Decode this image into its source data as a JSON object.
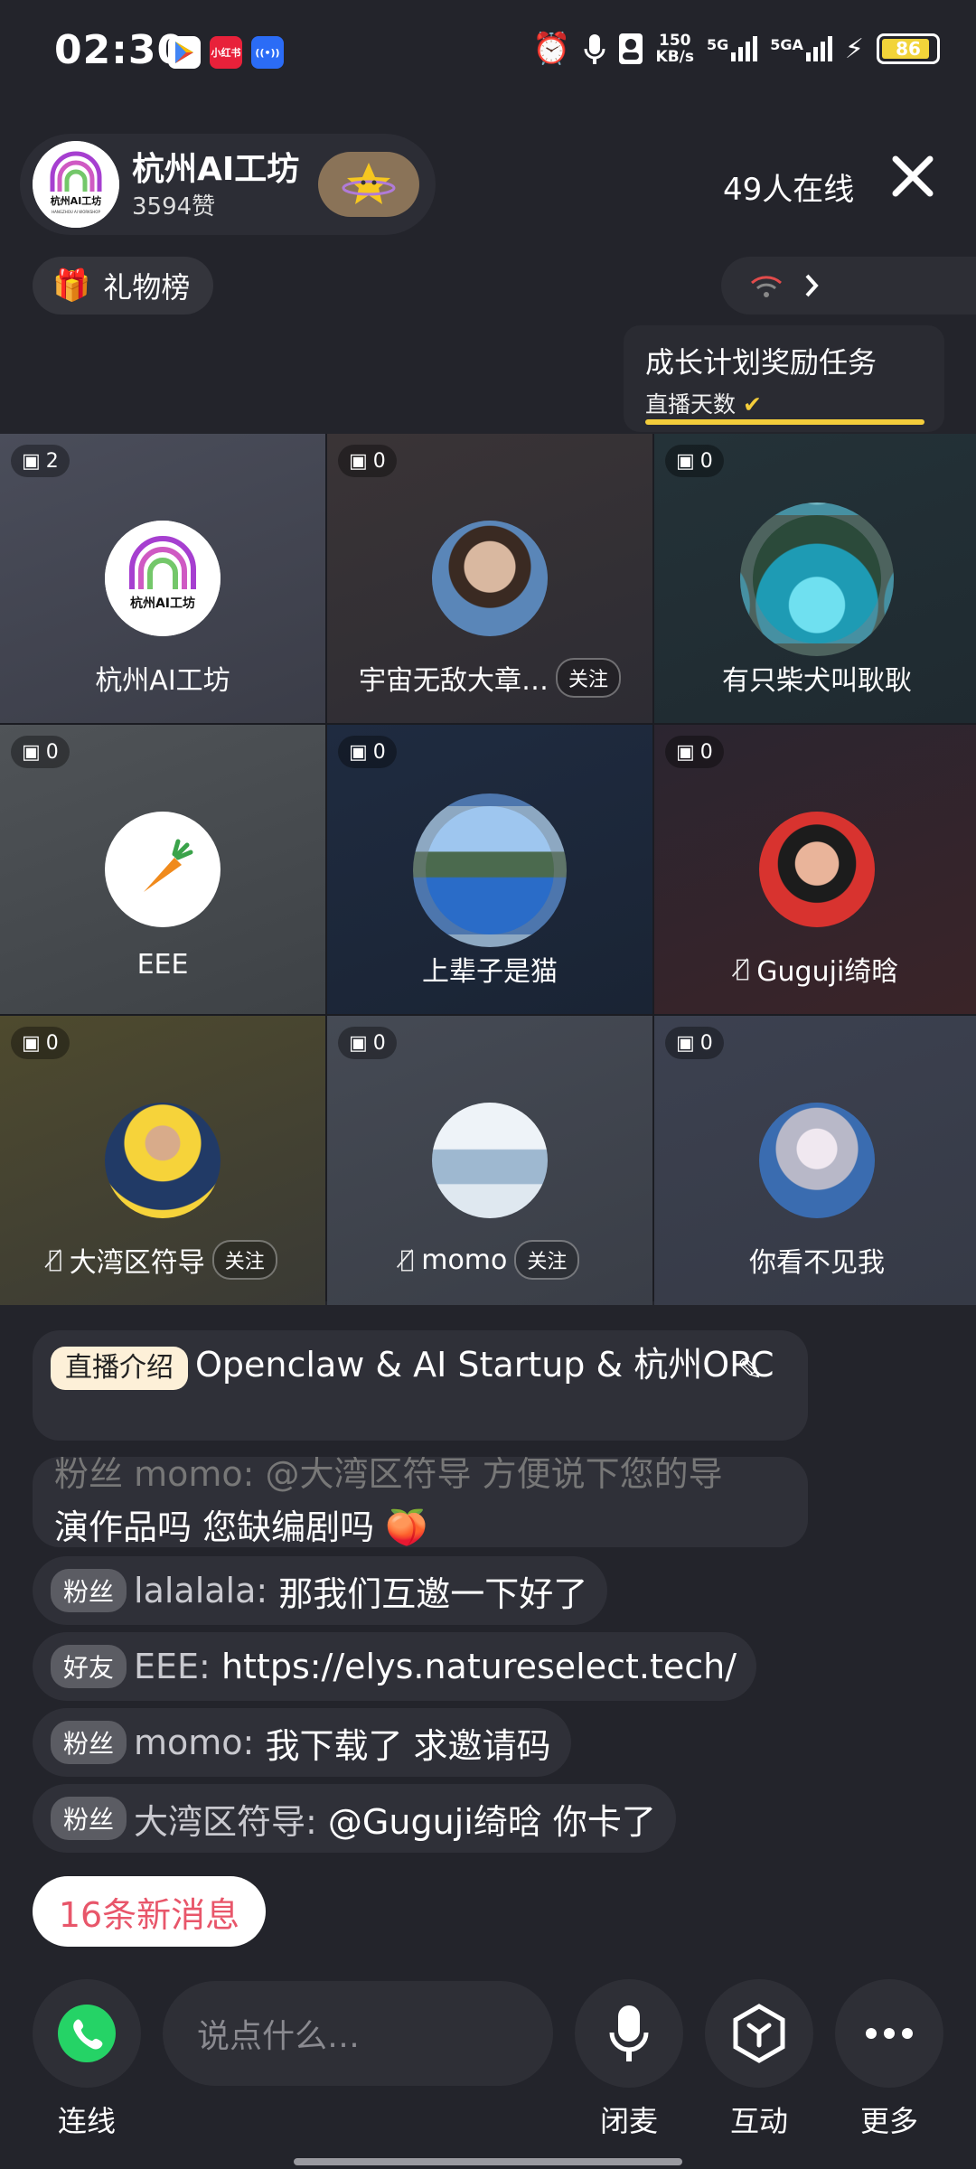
{
  "status_bar": {
    "time": "02:30",
    "speed_value": "150",
    "speed_unit": "KB/s",
    "net1": "5G",
    "net2": "5GA",
    "battery": "86",
    "red_app_label": "小红书"
  },
  "header": {
    "room_name": "杭州AI工坊",
    "likes": "3594赞",
    "online": "49人在线",
    "logo_text": "杭州AI工坊",
    "logo_subtext": "HANGZHOU AI WORKSHOP"
  },
  "gift_rank": {
    "label": "礼物榜"
  },
  "task": {
    "title": "成长计划奖励任务",
    "subtitle": "直播天数"
  },
  "seats": [
    {
      "name": "杭州AI工坊",
      "gifts": "2",
      "follow": "",
      "muted": false
    },
    {
      "name": "宇宙无敌大章…",
      "gifts": "0",
      "follow": "关注",
      "muted": false
    },
    {
      "name": "有只柴犬叫耿耿",
      "gifts": "0",
      "follow": "",
      "muted": false
    },
    {
      "name": "EEE",
      "gifts": "0",
      "follow": "",
      "muted": false
    },
    {
      "name": "上辈子是猫",
      "gifts": "0",
      "follow": "",
      "muted": false
    },
    {
      "name": "Guguji绮晗",
      "gifts": "0",
      "follow": "",
      "muted": true
    },
    {
      "name": "大湾区符导",
      "gifts": "0",
      "follow": "关注",
      "muted": true
    },
    {
      "name": "momo",
      "gifts": "0",
      "follow": "关注",
      "muted": true
    },
    {
      "name": "你看不见我",
      "gifts": "0",
      "follow": "",
      "muted": false
    }
  ],
  "intro": {
    "tag": "直播介绍",
    "text": "Openclaw & AI Startup & 杭州OPC"
  },
  "messages": {
    "partial_top": "粉丝 momo: @大湾区符导 方便说下您的导",
    "partial_text": "演作品吗 您缺编剧吗",
    "items": [
      {
        "tag": "粉丝",
        "user": "lalalala:",
        "text": "那我们互邀一下好了"
      },
      {
        "tag": "好友",
        "user": "EEE:",
        "text": "https://elys.natureselect.tech/"
      },
      {
        "tag": "粉丝",
        "user": "momo:",
        "text": "我下载了 求邀请码"
      },
      {
        "tag": "粉丝",
        "user": "大湾区符导:",
        "text": "@Guguji绮晗 你卡了"
      }
    ]
  },
  "new_messages": "16条新消息",
  "bottom_bar": {
    "connect": "连线",
    "input_placeholder": "说点什么…",
    "mic": "闭麦",
    "interact": "互动",
    "more": "更多"
  },
  "colors": {
    "background": "#23242b",
    "accent_yellow": "#f4cd3b",
    "new_msg_red": "#e8566a",
    "whatsapp_green": "#25d366"
  }
}
